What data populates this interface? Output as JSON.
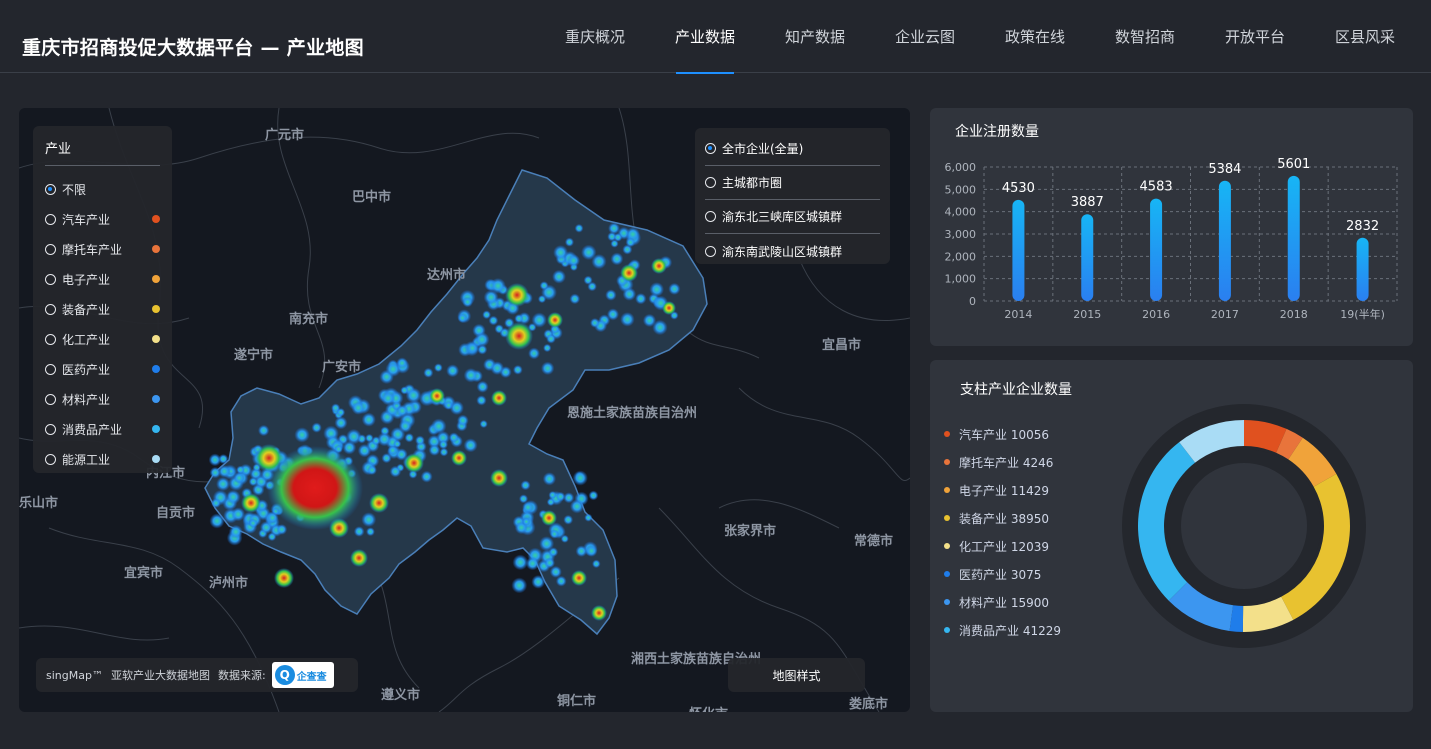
{
  "header": {
    "title": "重庆市招商投促大数据平台 — 产业地图",
    "nav": [
      {
        "label": "重庆概况",
        "active": false
      },
      {
        "label": "产业数据",
        "active": true
      },
      {
        "label": "知产数据",
        "active": false
      },
      {
        "label": "企业云图",
        "active": false
      },
      {
        "label": "政策在线",
        "active": false
      },
      {
        "label": "数智招商",
        "active": false
      },
      {
        "label": "开放平台",
        "active": false
      },
      {
        "label": "区县风采",
        "active": false
      }
    ]
  },
  "map": {
    "city_labels": [
      "广元市",
      "巴中市",
      "达州市",
      "南充市",
      "遂宁市",
      "广安市",
      "内江市",
      "乐山市",
      "自贡市",
      "宜宾市",
      "泸州市",
      "宜昌市",
      "恩施土家族苗族自治州",
      "张家界市",
      "常德市",
      "湘西土家族苗族自治州",
      "铜仁市",
      "遵义市",
      "娄底市",
      "怀化市"
    ],
    "industry_legend": {
      "title": "产业",
      "items": [
        {
          "label": "不限",
          "selected": true,
          "color": ""
        },
        {
          "label": "汽车产业",
          "selected": false,
          "color": "#e0511f"
        },
        {
          "label": "摩托车产业",
          "selected": false,
          "color": "#e8743b"
        },
        {
          "label": "电子产业",
          "selected": false,
          "color": "#f0a33a"
        },
        {
          "label": "装备产业",
          "selected": false,
          "color": "#e8c230"
        },
        {
          "label": "化工产业",
          "selected": false,
          "color": "#f3e08a"
        },
        {
          "label": "医药产业",
          "selected": false,
          "color": "#1f7dea"
        },
        {
          "label": "材料产业",
          "selected": false,
          "color": "#3c96f0"
        },
        {
          "label": "消费品产业",
          "selected": false,
          "color": "#35b6f0"
        },
        {
          "label": "能源工业",
          "selected": false,
          "color": "#a9dcf5"
        }
      ]
    },
    "regions": [
      {
        "label": "全市企业(全量)",
        "selected": true
      },
      {
        "label": "主城都市圈",
        "selected": false
      },
      {
        "label": "渝东北三峡库区城镇群",
        "selected": false
      },
      {
        "label": "渝东南武陵山区城镇群",
        "selected": false
      }
    ],
    "attribution": {
      "brand": "singMap™",
      "text": "亚软产业大数据地图",
      "source_label": "数据来源:",
      "logo_text": "企查查"
    },
    "style_button": "地图样式"
  },
  "bar_panel": {
    "title": "企业注册数量"
  },
  "chart_data": [
    {
      "type": "bar",
      "title": "企业注册数量",
      "categories": [
        "2014",
        "2015",
        "2016",
        "2017",
        "2018",
        "19(半年)"
      ],
      "values": [
        4530,
        3887,
        4583,
        5384,
        5601,
        2832
      ],
      "ylim": [
        0,
        6000
      ],
      "yticks": [
        "6,000",
        "5,000",
        "4,000",
        "3,000",
        "2,000",
        "1,000",
        "0"
      ],
      "grid": true,
      "colors": [
        "#17b5f5",
        "#2a7ff0"
      ]
    },
    {
      "type": "pie",
      "title": "支柱产业企业数量",
      "legend_position": "left",
      "labels": [
        "汽车产业",
        "摩托车产业",
        "电子产业",
        "装备产业",
        "化工产业",
        "医药产业",
        "材料产业",
        "消费品产业",
        "能源工业"
      ],
      "legend_labels": [
        "汽车产业 10056",
        "摩托车产业 4246",
        "电子产业 11429",
        "装备产业 38950",
        "化工产业 12039",
        "医药产业 3075",
        "材料产业 15900",
        "消费品产业 41229"
      ],
      "values": [
        10056,
        4246,
        11429,
        38950,
        12039,
        3075,
        15900,
        41229,
        16000
      ],
      "colors": [
        "#e0511f",
        "#e8743b",
        "#f0a33a",
        "#e8c230",
        "#f3e08a",
        "#1f7dea",
        "#3c96f0",
        "#35b6f0",
        "#a9dcf5"
      ]
    }
  ]
}
